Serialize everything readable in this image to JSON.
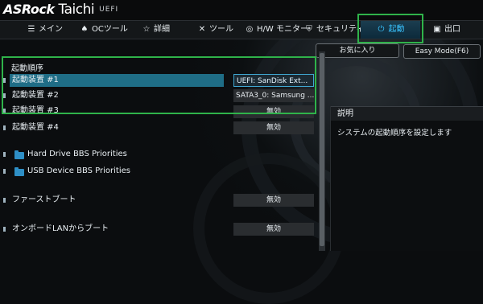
{
  "header": {
    "brand": "ASRock",
    "model": "Taichi",
    "uefi": "UEFI"
  },
  "nav": {
    "tabs": [
      {
        "label": "メイン",
        "icon": "list-icon"
      },
      {
        "label": "OCツール",
        "icon": "flame-icon"
      },
      {
        "label": "詳細",
        "icon": "star-icon"
      },
      {
        "label": "ツール",
        "icon": "tools-icon"
      },
      {
        "label": "H/W モニター",
        "icon": "monitor-icon"
      },
      {
        "label": "セキュリティ",
        "icon": "shield-icon"
      },
      {
        "label": "起動",
        "icon": "power-icon",
        "active": true
      },
      {
        "label": "出口",
        "icon": "exit-icon"
      }
    ]
  },
  "top_buttons": {
    "favorites": "お気に入り",
    "easy_mode": "Easy Mode(F6)"
  },
  "boot": {
    "section_title": "起動順序",
    "devices": [
      {
        "label": "起動装置 #1",
        "value": "UEFI: SanDisk Ext..."
      },
      {
        "label": "起動装置 #2",
        "value": "SATA3_0: Samsung ..."
      },
      {
        "label": "起動装置 #3",
        "value": "無効"
      },
      {
        "label": "起動装置 #4",
        "value": "無効"
      }
    ],
    "folders": [
      {
        "label": "Hard Drive BBS Priorities"
      },
      {
        "label": "USB Device BBS Priorities"
      }
    ],
    "options": [
      {
        "label": "ファーストブート",
        "value": "無効"
      },
      {
        "label": "オンボードLANからブート",
        "value": "無効"
      }
    ]
  },
  "description": {
    "title": "説明",
    "text": "システムの起動順序を設定します"
  },
  "colors": {
    "accent": "#39c3ff",
    "highlight_box": "#2fb34a",
    "selected_row": "#1f6d86"
  }
}
